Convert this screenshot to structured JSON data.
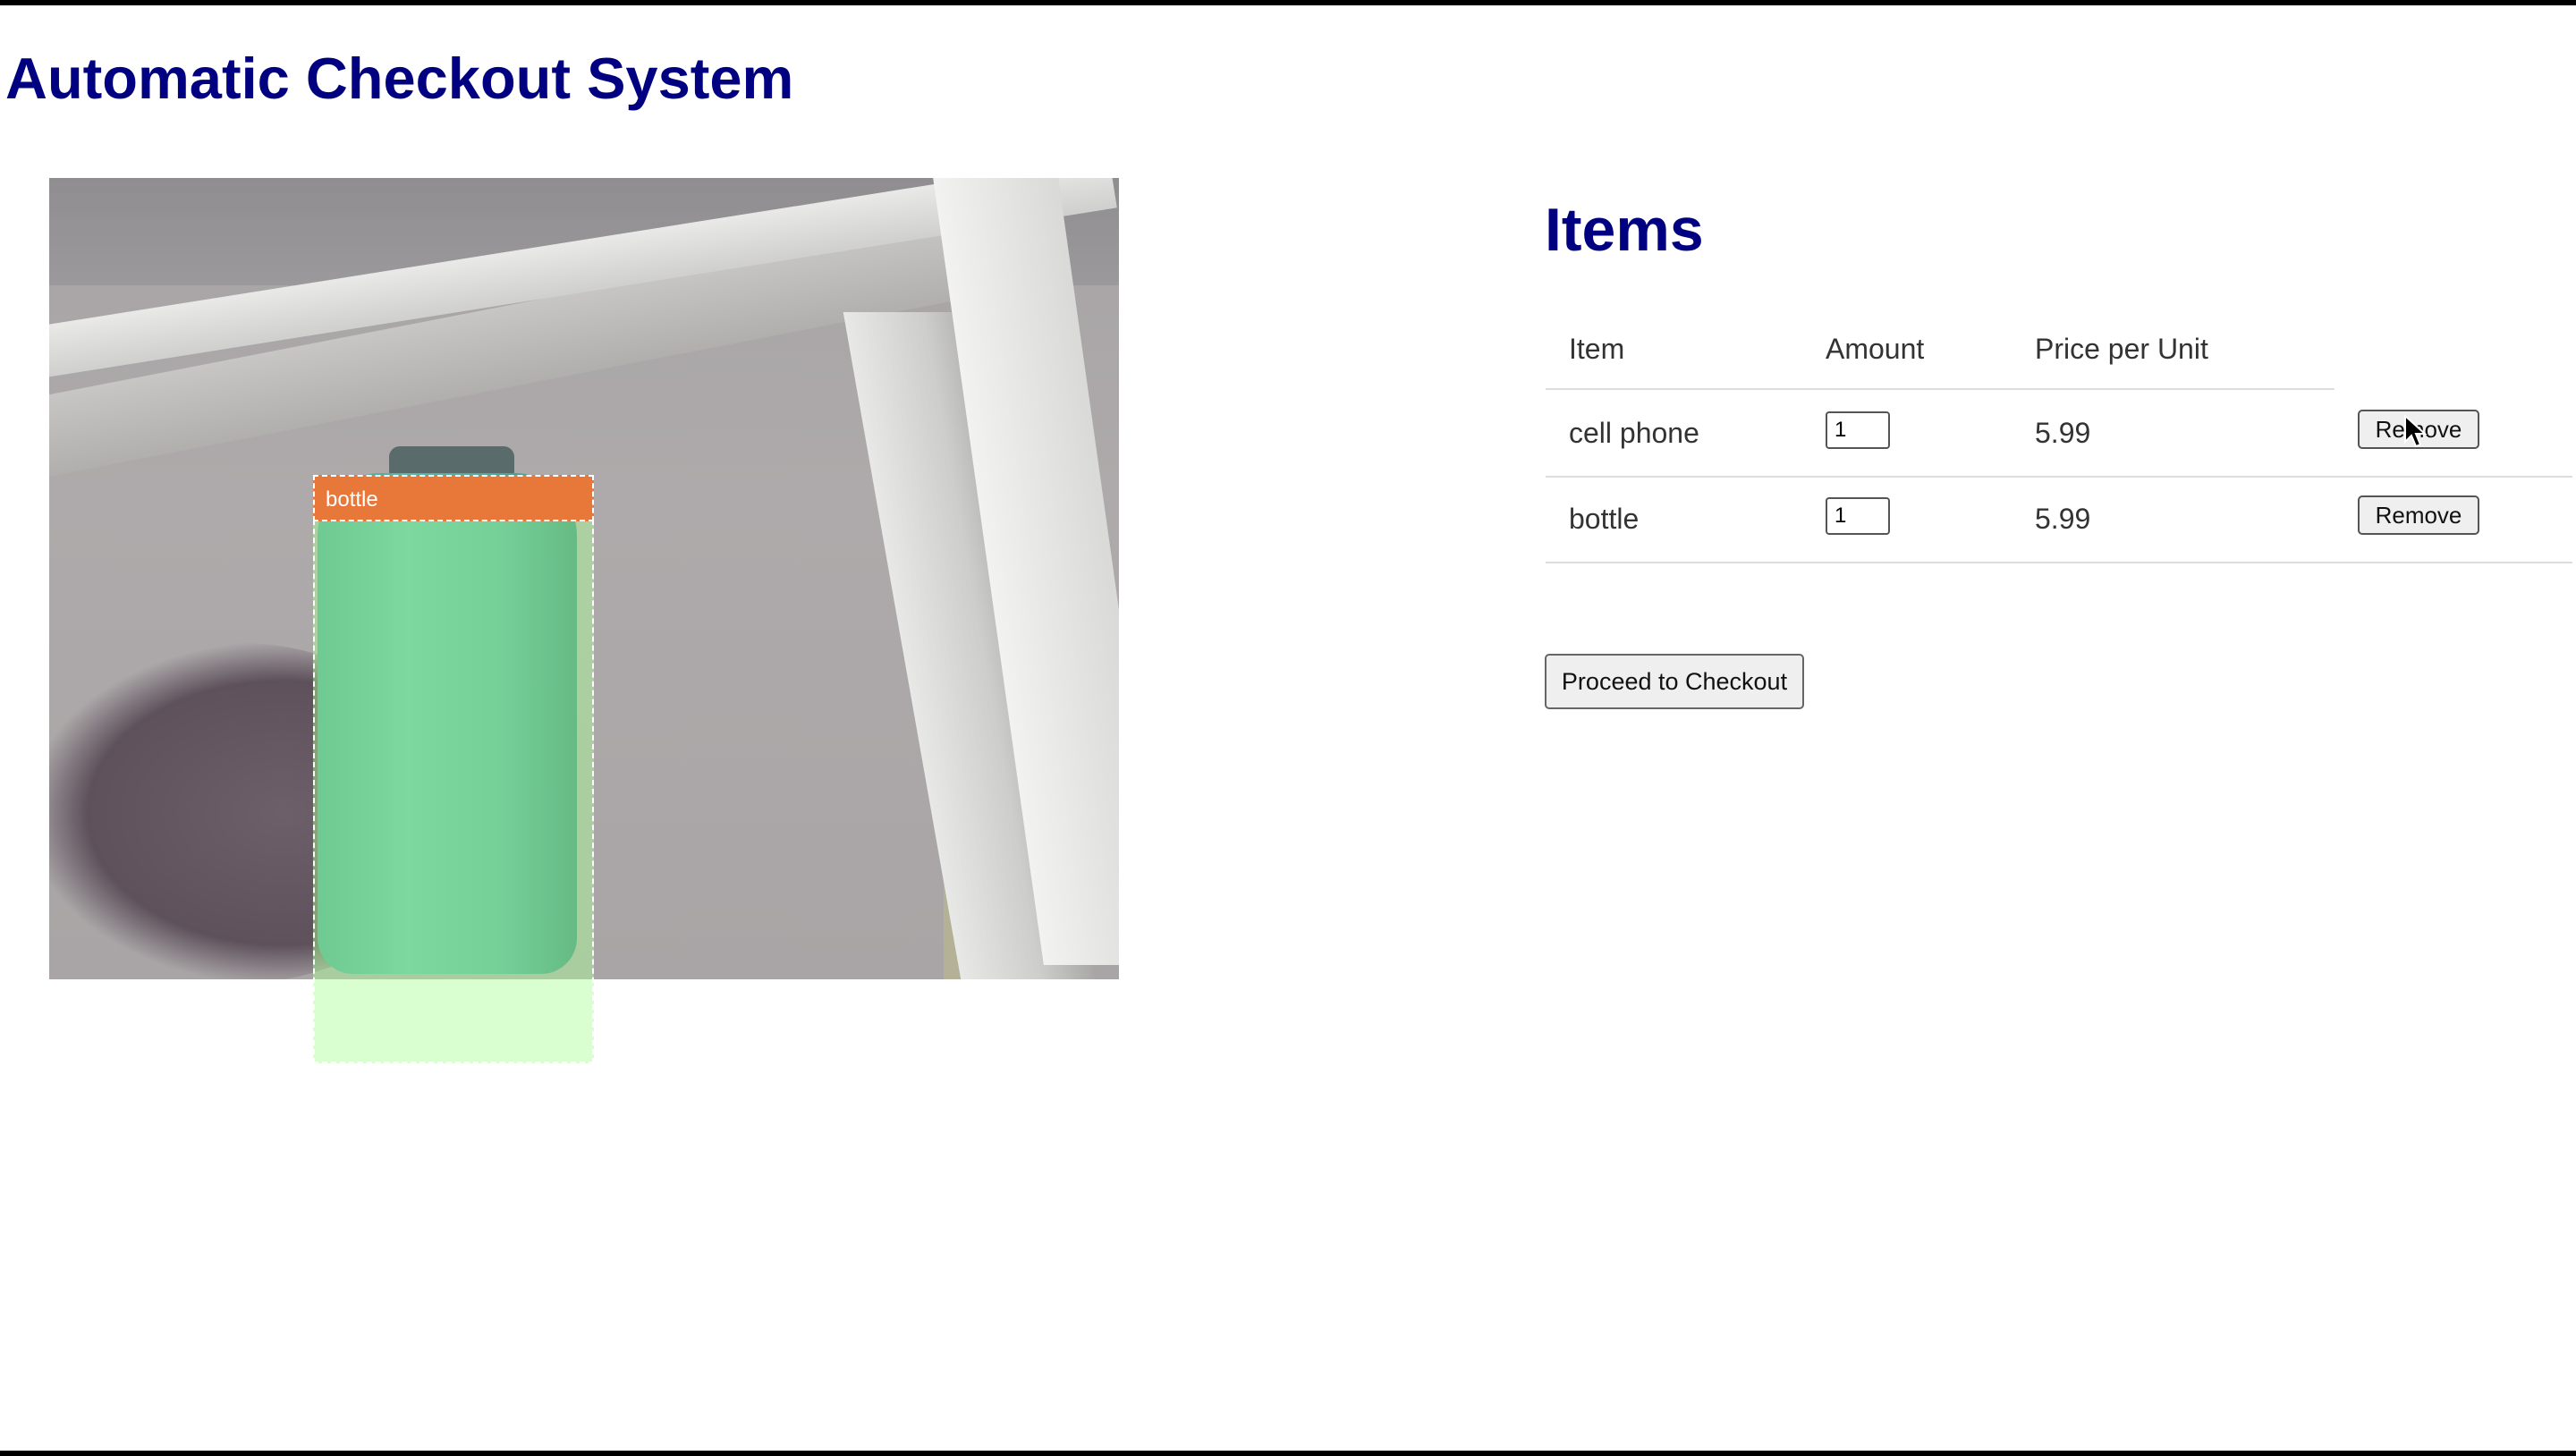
{
  "page": {
    "title": "Automatic Checkout System"
  },
  "camera": {
    "detection": {
      "label": "bottle"
    }
  },
  "items": {
    "title": "Items",
    "columns": {
      "item": "Item",
      "amount": "Amount",
      "price": "Price per Unit"
    },
    "rows": [
      {
        "name": "cell phone",
        "amount": "1",
        "price": "5.99",
        "remove_label": "Remove"
      },
      {
        "name": "bottle",
        "amount": "1",
        "price": "5.99",
        "remove_label": "Remove"
      }
    ],
    "checkout_label": "Proceed to Checkout"
  }
}
